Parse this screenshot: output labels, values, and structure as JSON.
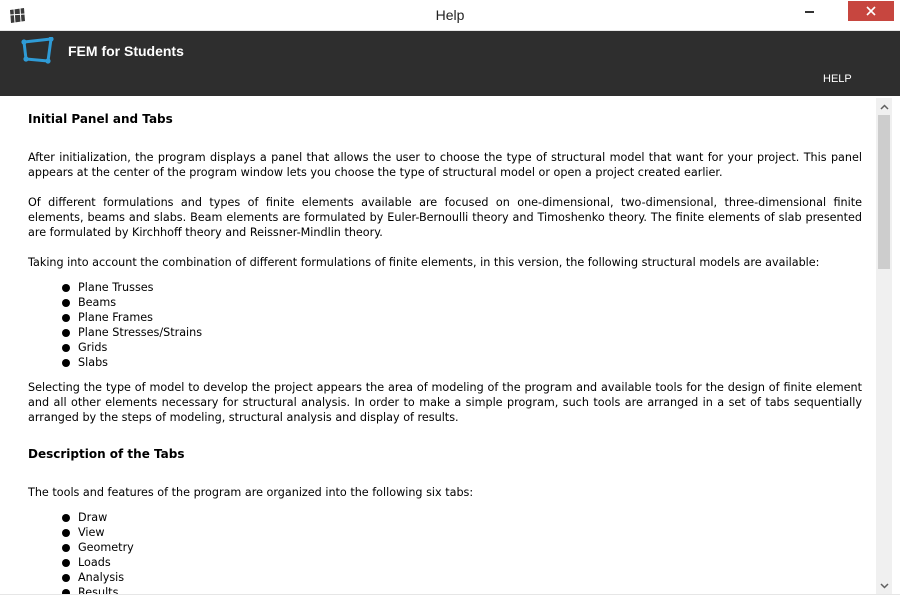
{
  "window": {
    "title": "Help"
  },
  "app_header": {
    "name": "FEM for Students",
    "help_link": "HELP"
  },
  "content": {
    "section1_title": "Initial Panel and Tabs",
    "p1": "After initialization, the program displays a panel that allows the user to choose the type of structural model that want for your project. This panel appears at the center of the program window lets you choose the type of structural model or open a project created earlier.",
    "p2": "Of different formulations and types of finite elements available are focused on one-dimensional, two-dimensional, three-dimensional finite elements, beams and slabs. Beam elements are formulated by Euler-Bernoulli theory and Timoshenko theory. The finite elements of slab presented are formulated by Kirchhoff theory and Reissner-Mindlin theory.",
    "p3": "Taking into account the combination of different formulations of finite elements, in this version, the following structural models are available:",
    "models": [
      "Plane Trusses",
      "Beams",
      "Plane Frames",
      "Plane Stresses/Strains",
      "Grids",
      "Slabs"
    ],
    "p4": "Selecting the type of model to develop the project appears the area of modeling of the program and available tools for the design of finite element and all other elements necessary for structural analysis. In order to make a simple program, such tools are arranged in a set of tabs sequentially arranged by the steps of modeling, structural analysis and display of results.",
    "section2_title": "Description of the Tabs",
    "p5": "The tools and features of the program are organized into the following six tabs:",
    "tabs": [
      "Draw",
      "View",
      "Geometry",
      "Loads",
      "Analysis",
      "Results"
    ]
  },
  "icons": {
    "app": "window-app-icon",
    "logo": "quadrilateral-element-logo",
    "minimize": "minimize-icon",
    "close": "close-icon",
    "scroll_up": "chevron-up-icon",
    "scroll_down": "chevron-down-icon"
  },
  "colors": {
    "header_bg": "#2e2e2e",
    "logo_accent": "#2f9bd6",
    "close_button": "#c7463f"
  }
}
